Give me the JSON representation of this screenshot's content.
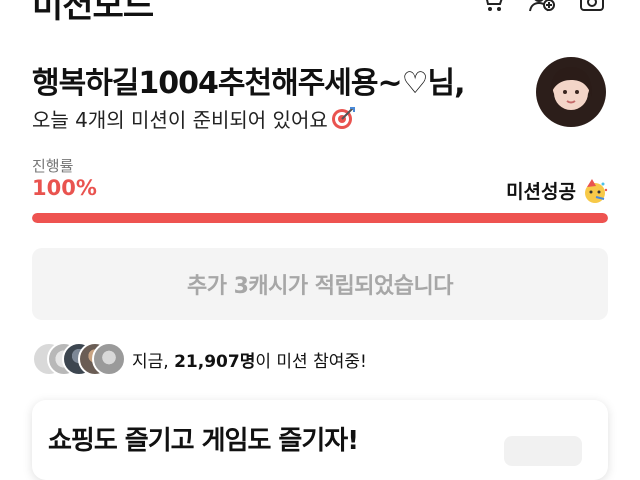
{
  "header": {
    "title": "미션모드",
    "icons": [
      "cart-icon",
      "add-user-icon",
      "camera-icon"
    ]
  },
  "greeting": {
    "title": "행복하길1004추천해주세용~♡님,",
    "subtitle": "오늘 4개의 미션이 준비되어 있어요"
  },
  "progress": {
    "label": "진행률",
    "percent_text": "100%",
    "value": 1.0,
    "status": "미션성공",
    "accent": "#ee5350"
  },
  "reward_button": {
    "label": "추가 3캐시가 적립되었습니다"
  },
  "participants": {
    "prefix": "지금, ",
    "count": "21,907명",
    "suffix": "이 미션 참여중!"
  },
  "promo_card": {
    "title": "쇼핑도 즐기고 게임도 즐기자!"
  }
}
